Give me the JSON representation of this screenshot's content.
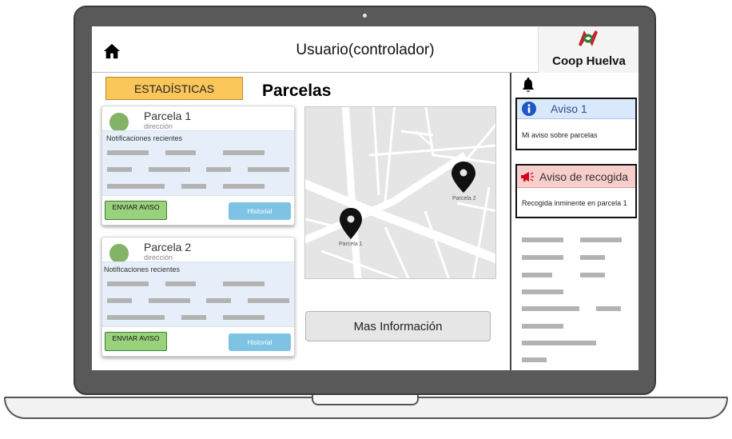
{
  "header": {
    "title": "Usuario(controlador)",
    "logo_text": "Coop Huelva",
    "home_icon": "home-icon"
  },
  "toolbar": {
    "stats_label": "ESTADÍSTICAS",
    "section_title": "Parcelas"
  },
  "cards": [
    {
      "name": "Parcela 1",
      "address": "dirección",
      "notifications_title": "Notificaciones recientes",
      "send_label": "ENVIAR AVISO",
      "history_label": "Historial"
    },
    {
      "name": "Parcela 2",
      "address": "dirección",
      "notifications_title": "Notificaciones recientes",
      "send_label": "ENVIAR AVISO",
      "history_label": "Historial"
    }
  ],
  "map": {
    "pins": [
      {
        "label": "Parcela 1"
      },
      {
        "label": "Parcela 2"
      }
    ],
    "more_label": "Mas Información"
  },
  "notices": {
    "bell_icon": "bell-icon",
    "aviso_info": {
      "title": "Aviso 1",
      "body": "Mi aviso sobre parcelas",
      "icon": "info-icon",
      "color": "#dae8fc"
    },
    "aviso_recogida": {
      "title": "Aviso de recogida",
      "body": "Recogida inminente en parcela 1",
      "icon": "megaphone-icon",
      "color": "#f8cecc"
    }
  },
  "colors": {
    "stats_button": "#fbc65a",
    "send_button": "#99d27d",
    "history_button": "#7ec3e4",
    "avatar": "#82b366"
  }
}
